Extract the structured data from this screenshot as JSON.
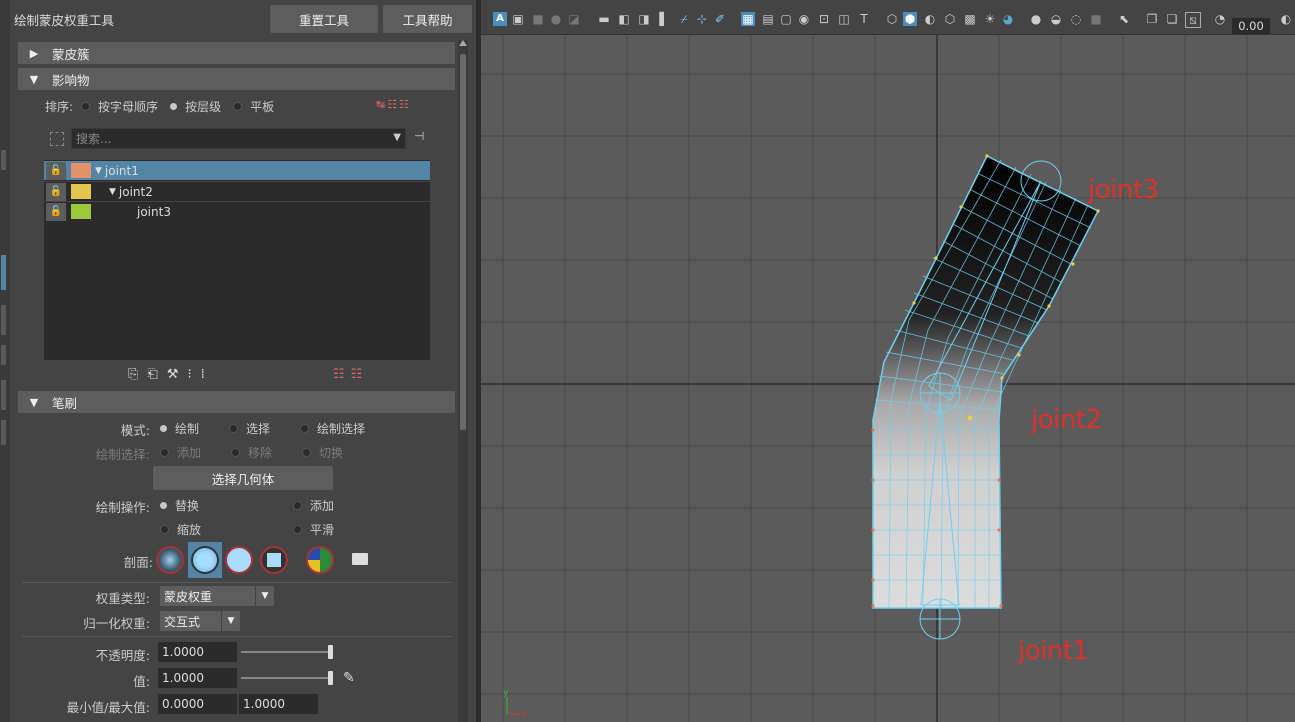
{
  "tool": {
    "title": "绘制蒙皮权重工具",
    "reset_label": "重置工具",
    "help_label": "工具帮助"
  },
  "sections": {
    "skin_cluster": "蒙皮簇",
    "influences": "影响物",
    "brush": "笔刷"
  },
  "sort": {
    "label": "排序:",
    "options": [
      "按字母顺序",
      "按层级",
      "平板"
    ],
    "selected": "按层级"
  },
  "search": {
    "placeholder": "搜索..."
  },
  "influence_list": [
    {
      "name": "joint1",
      "color": "#e3916a",
      "selected": true
    },
    {
      "name": "joint2",
      "color": "#e4c64c",
      "selected": false
    },
    {
      "name": "joint3",
      "color": "#9ac93f",
      "selected": false
    }
  ],
  "brush": {
    "mode_label": "模式:",
    "mode_options": [
      "绘制",
      "选择",
      "绘制选择"
    ],
    "mode_selected": "绘制",
    "paint_select_label": "绘制选择:",
    "paint_select_options": [
      "添加",
      "移除",
      "切换"
    ],
    "select_geometry_label": "选择几何体",
    "paint_op_label": "绘制操作:",
    "paint_op_options": [
      "替换",
      "添加",
      "缩放",
      "平滑"
    ],
    "paint_op_selected": "替换",
    "profile_label": "剖面:",
    "weight_type_label": "权重类型:",
    "weight_type_value": "蒙皮权重",
    "normalize_label": "归一化权重:",
    "normalize_value": "交互式",
    "opacity_label": "不透明度:",
    "opacity_value": "1.0000",
    "opacity_level": 1.0,
    "value_label": "值:",
    "value_value": "1.0000",
    "value_level": 1.0,
    "minmax_label": "最小值/最大值:",
    "min_value": "0.0000",
    "max_value": "1.0000"
  },
  "viewport": {
    "time_value": "0.00",
    "joint_labels": [
      "joint3",
      "joint2",
      "joint1"
    ],
    "axis_x": "x",
    "axis_y": "y",
    "label_color": "#e0302a"
  }
}
